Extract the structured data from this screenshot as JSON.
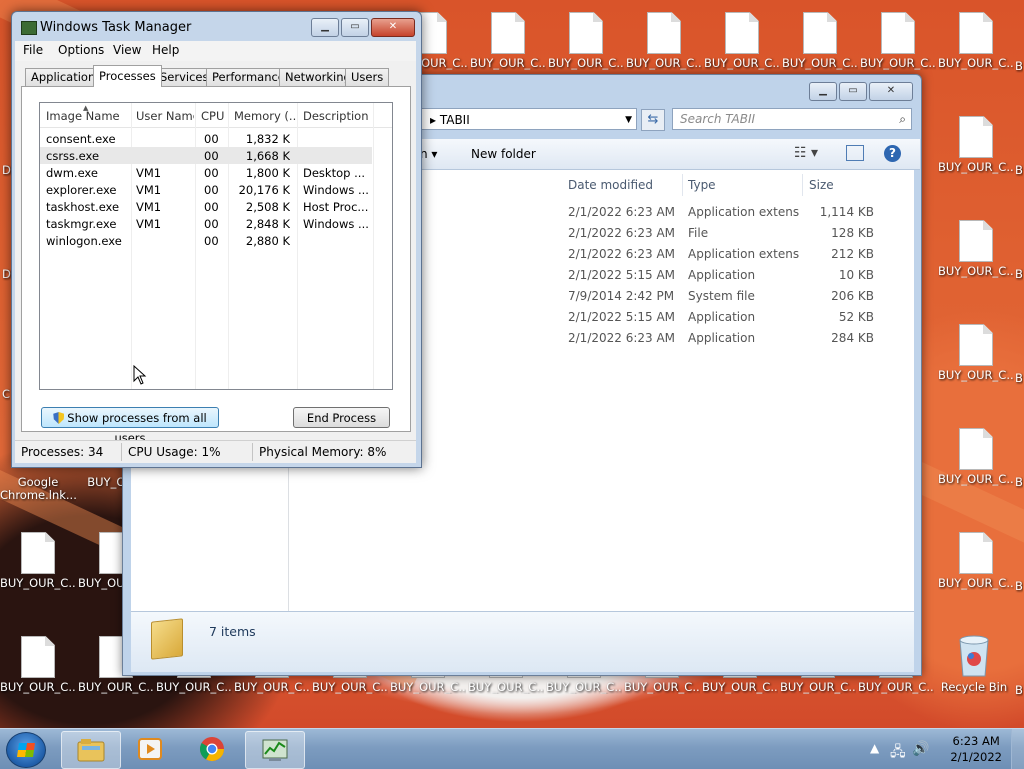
{
  "desktop": {
    "icons": [
      {
        "label": "BUY_OUR_C..."
      },
      {
        "label": "BUY_OUR_C..."
      },
      {
        "label": "BUY_OUR_C..."
      },
      {
        "label": "BUY_OUR_C..."
      },
      {
        "label": "BUY_OUR_C..."
      },
      {
        "label": "BUY_OUR_C..."
      },
      {
        "label": "BUY_OUR_C..."
      },
      {
        "label": "BUY_OUR_C..."
      },
      {
        "label": "BUY_OUR_C..."
      },
      {
        "label": "BUY_OUR_C..."
      },
      {
        "label": "BUY_OUR_C..."
      },
      {
        "label": "BUY_OUR_C..."
      },
      {
        "label": "BUY_OUR_C..."
      },
      {
        "label": "BUY_OUR_C..."
      },
      {
        "label": "BUY_OUR_C..."
      },
      {
        "label": "BUY_OUR_C..."
      },
      {
        "label": "BUY_OUR_C..."
      },
      {
        "label": "BUY_OUR_C..."
      },
      {
        "label": "BUY_OUR_C..."
      },
      {
        "label": "BUY_OUR_C..."
      },
      {
        "label": "BUY_OUR_C..."
      },
      {
        "label": "BUY_OUR_C..."
      },
      {
        "label": "BUY_OUR_C..."
      },
      {
        "label": "BUY_OUR_C..."
      },
      {
        "label": "BUY_OUR_C..."
      },
      {
        "label": "BUY_OUR_C..."
      },
      {
        "label": "BUY_OUR_C..."
      },
      {
        "label": "Google Chrome.lnk..."
      },
      {
        "label": "BUY_OU..."
      },
      {
        "label": "BUY_OUR_C..."
      },
      {
        "label": "BUY_OUR_C..."
      },
      {
        "label": "BUY_OUR_C..."
      },
      {
        "label": "BUY_OUR_C..."
      },
      {
        "label": "Recycle Bin"
      },
      {
        "label": "B"
      },
      {
        "label": "B"
      },
      {
        "label": "B"
      },
      {
        "label": "B"
      },
      {
        "label": "B"
      },
      {
        "label": "B"
      },
      {
        "label": "B"
      },
      {
        "label": "D"
      },
      {
        "label": "D"
      },
      {
        "label": "C"
      }
    ]
  },
  "explorer": {
    "address": "TABII",
    "search_placeholder": "Search TABII",
    "new_folder": "New folder",
    "organize_glyph": "n ▾",
    "columns": {
      "date": "Date modified",
      "type": "Type",
      "size": "Size"
    },
    "files": [
      {
        "date": "2/1/2022 6:23 AM",
        "type": "Application extens...",
        "size": "1,114 KB"
      },
      {
        "date": "2/1/2022 6:23 AM",
        "type": "File",
        "size": "128 KB"
      },
      {
        "date": "2/1/2022 6:23 AM",
        "type": "Application extens...",
        "size": "212 KB"
      },
      {
        "date": "2/1/2022 5:15 AM",
        "type": "Application",
        "size": "10 KB"
      },
      {
        "date": "7/9/2014 2:42 PM",
        "type": "System file",
        "size": "206 KB"
      },
      {
        "date": "2/1/2022 5:15 AM",
        "type": "Application",
        "size": "52 KB"
      },
      {
        "date": "2/1/2022 6:23 AM",
        "type": "Application",
        "size": "284 KB"
      }
    ],
    "item_count": "7 items"
  },
  "taskmgr": {
    "title": "Windows Task Manager",
    "menu": [
      "File",
      "Options",
      "View",
      "Help"
    ],
    "tabs": [
      "Applications",
      "Processes",
      "Services",
      "Performance",
      "Networking",
      "Users"
    ],
    "active_tab": "Processes",
    "columns": {
      "image": "Image Name",
      "user": "User Name",
      "cpu": "CPU",
      "memory": "Memory (...",
      "desc": "Description"
    },
    "processes": [
      {
        "image": "consent.exe",
        "user": "",
        "cpu": "00",
        "memory": "1,832 K",
        "desc": ""
      },
      {
        "image": "csrss.exe",
        "user": "",
        "cpu": "00",
        "memory": "1,668 K",
        "desc": ""
      },
      {
        "image": "dwm.exe",
        "user": "VM1",
        "cpu": "00",
        "memory": "1,800 K",
        "desc": "Desktop ..."
      },
      {
        "image": "explorer.exe",
        "user": "VM1",
        "cpu": "00",
        "memory": "20,176 K",
        "desc": "Windows ..."
      },
      {
        "image": "taskhost.exe",
        "user": "VM1",
        "cpu": "00",
        "memory": "2,508 K",
        "desc": "Host Proc..."
      },
      {
        "image": "taskmgr.exe",
        "user": "VM1",
        "cpu": "00",
        "memory": "2,848 K",
        "desc": "Windows ..."
      },
      {
        "image": "winlogon.exe",
        "user": "",
        "cpu": "00",
        "memory": "2,880 K",
        "desc": ""
      }
    ],
    "show_all_button": "Show processes from all users",
    "end_process_button": "End Process",
    "status": {
      "processes": "Processes: 34",
      "cpu": "CPU Usage: 1%",
      "memory": "Physical Memory: 8%"
    }
  },
  "taskbar": {
    "time": "6:23 AM",
    "date": "2/1/2022"
  },
  "colors": {
    "accent": "#2e67b1",
    "selection": "#e8e8e8",
    "taskbar": "#7d9cc0"
  }
}
